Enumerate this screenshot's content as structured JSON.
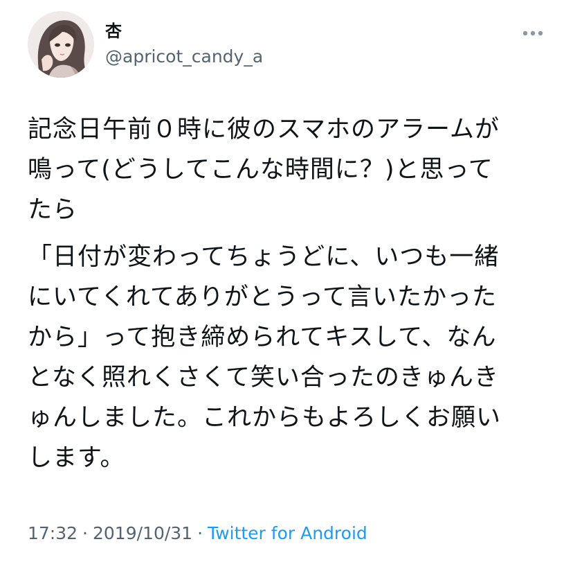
{
  "tweet": {
    "author": {
      "display_name": "杏",
      "handle": "@apricot_candy_a",
      "avatar_icon": "anime-girl-avatar-icon"
    },
    "more_icon": "ellipsis-icon",
    "paragraphs": [
      "記念日午前０時に彼のスマホのアラームが\n鳴って(どうしてこんな時間に？)と思って\nたら",
      "「日付が変わってちょうどに、いつも一緒\nにいてくれてありがとうって言いたかった\nから」って抱き締められてキスして、なん\nとなく照れくさくて笑い合ったのきゅんき\nゅんしました。これからもよろしくお願い\nします。"
    ],
    "time": "17:32",
    "separator": "·",
    "date": "2019/10/31",
    "source": "Twitter for Android"
  },
  "colors": {
    "text_primary": "#0f1419",
    "text_secondary": "#536471",
    "link": "#1d9bf0",
    "background": "#ffffff"
  }
}
